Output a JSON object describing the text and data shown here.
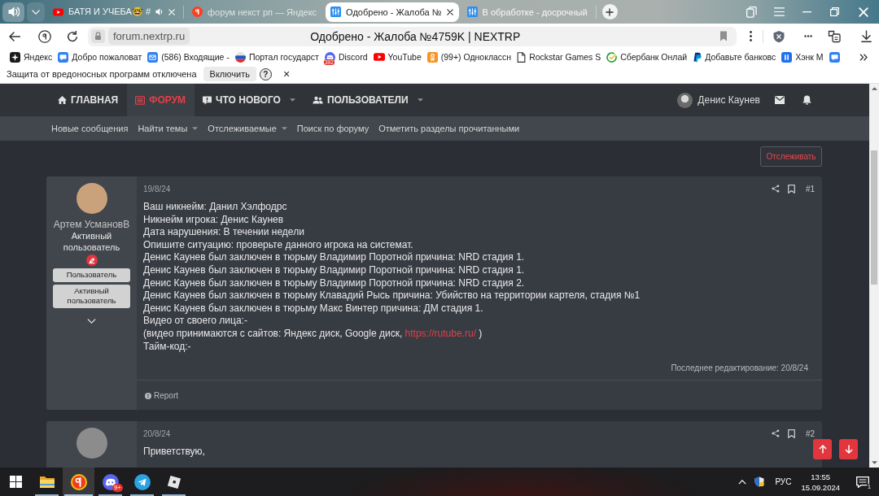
{
  "browser": {
    "tabs": [
      {
        "kind": "video",
        "title": "БАТЯ И УЧЕБА🤓 #",
        "selected": false,
        "playing": true,
        "closable": true
      },
      {
        "kind": "search",
        "title": "форум некст рп — Яндекс",
        "selected": false,
        "playing": false,
        "closable": false
      },
      {
        "kind": "forum",
        "title": "Одобрено - Жалоба №",
        "selected": true,
        "playing": false,
        "closable": true
      },
      {
        "kind": "forum",
        "title": "В обработке - досрочный",
        "selected": false,
        "playing": false,
        "closable": false
      }
    ],
    "address": {
      "url": "forum.nextrp.ru",
      "page_title": "Одобрено - Жалоба №4759K | NEXTRP"
    },
    "bookmarks": [
      {
        "kind": "sparkle",
        "label": "Яндекс"
      },
      {
        "kind": "chat",
        "label": "Добро пожаловат"
      },
      {
        "kind": "mail",
        "label": "(586) Входящие -"
      },
      {
        "kind": "flag",
        "label": "Портал государст"
      },
      {
        "kind": "discord",
        "label": "Discord",
        "badge": "392"
      },
      {
        "kind": "video",
        "label": "YouTube"
      },
      {
        "kind": "social",
        "label": "(99+) Одноклассн"
      },
      {
        "kind": "page",
        "label": "Rockstar Games S"
      },
      {
        "kind": "check",
        "label": "Сбербанк Онлай"
      },
      {
        "kind": "payment",
        "label": "Добавьте банковс"
      },
      {
        "kind": "pause",
        "label": "Хэнк М"
      },
      {
        "kind": "chat"
      }
    ]
  },
  "notification_bar": {
    "message": "Защита от вредоносных программ отключена",
    "button": "Включить",
    "help": "?",
    "close": "×"
  },
  "forum": {
    "nav": [
      {
        "kind": "home",
        "label": "ГЛАВНАЯ",
        "selected": false,
        "dropdown": false
      },
      {
        "kind": "forum",
        "label": "ФОРУМ",
        "selected": true,
        "dropdown": false
      },
      {
        "kind": "whats_new",
        "label": "ЧТО НОВОГО",
        "selected": false,
        "dropdown": true
      },
      {
        "kind": "members",
        "label": "ПОЛЬЗОВАТЕЛИ",
        "selected": false,
        "dropdown": true
      }
    ],
    "user": {
      "name": "Денис Каунев"
    },
    "subnav": [
      {
        "label": "Новые сообщения",
        "dropdown": false
      },
      {
        "label": "Найти темы",
        "dropdown": true
      },
      {
        "label": "Отслеживаемые",
        "dropdown": true
      },
      {
        "label": "Поиск по форуму",
        "dropdown": false
      },
      {
        "label": "Отметить разделы прочитанными",
        "dropdown": false
      }
    ],
    "watch_button": "Отслеживать",
    "posts": [
      {
        "author": "Артем УсмановВ",
        "user_title": "Активный пользователь",
        "banners": [
          "Пользователь",
          "Активный пользователь"
        ],
        "date": "19/8/24",
        "number": "#1",
        "lines": [
          {
            "text": "Ваш никнейм: Данил Хэлфодрс"
          },
          {
            "text": "Никнейм игрока: Денис Каунев"
          },
          {
            "text": "Дата нарушения: В течении недели"
          },
          {
            "text": "Опишите ситуацию: проверьте данного игрока на системат."
          },
          {
            "text": "Денис Каунев был заключен в тюрьму Владимир Поротной причина: NRD стадия 1."
          },
          {
            "text": "Денис Каунев был заключен в тюрьму Владимир Поротной причина: NRD стадия 1."
          },
          {
            "text": "Денис Каунев был заключен в тюрьму Владимир Поротной причина: NRD стадия 2."
          },
          {
            "text": "Денис Каунев был заключен в тюрьму Клавадий Рысь причина: Убийство на территории картеля, стадия №1"
          },
          {
            "text": "Денис Каунев был заключен в тюрьму Макс Винтер причина: ДМ стадия 1."
          },
          {
            "text": "Видео от своего лица:-"
          },
          {
            "text": "(видео принимаются с сайтов: Яндекс диск, Google диск, ",
            "link": "https://rutube.ru/",
            "after": " )"
          },
          {
            "text": "Тайм-код:-"
          }
        ],
        "edited": "Последнее редактирование: 20/8/24",
        "report": "Report"
      },
      {
        "date": "20/8/24",
        "number": "#2",
        "lines": [
          {
            "text": "Приветствую,"
          }
        ]
      }
    ]
  },
  "taskbar": {
    "apps": [
      {
        "kind": "start",
        "selected": false,
        "running": false
      },
      {
        "kind": "folder",
        "selected": false,
        "running": true
      },
      {
        "kind": "browser",
        "selected": true,
        "running": true
      },
      {
        "kind": "chat",
        "selected": false,
        "running": true,
        "badge": "9+"
      },
      {
        "kind": "messenger",
        "selected": false,
        "running": true
      },
      {
        "kind": "game",
        "selected": false,
        "running": true
      }
    ],
    "language": "РУС",
    "time": "13:55",
    "date": "15.09.2024",
    "notifications": "1"
  }
}
